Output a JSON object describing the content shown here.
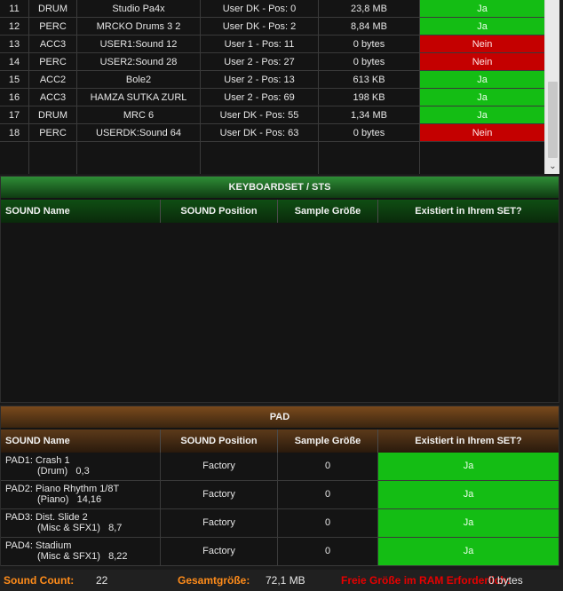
{
  "top_rows": [
    {
      "num": "11",
      "type": "DRUM",
      "name": "Studio Pa4x",
      "position": "User DK - Pos: 0",
      "size": "23,8 MB",
      "exists": "Ja",
      "ok": true
    },
    {
      "num": "12",
      "type": "PERC",
      "name": "MRCKO Drums 3  2",
      "position": "User DK - Pos: 2",
      "size": "8,84 MB",
      "exists": "Ja",
      "ok": true
    },
    {
      "num": "13",
      "type": "ACC3",
      "name": "USER1:Sound 12",
      "position": "User 1 - Pos: 11",
      "size": "0 bytes",
      "exists": "Nein",
      "ok": false
    },
    {
      "num": "14",
      "type": "PERC",
      "name": "USER2:Sound 28",
      "position": "User 2 - Pos: 27",
      "size": "0 bytes",
      "exists": "Nein",
      "ok": false
    },
    {
      "num": "15",
      "type": "ACC2",
      "name": "Bole2",
      "position": "User 2 - Pos: 13",
      "size": "613 KB",
      "exists": "Ja",
      "ok": true
    },
    {
      "num": "16",
      "type": "ACC3",
      "name": "HAMZA SUTKA ZURL",
      "position": "User 2 - Pos: 69",
      "size": "198 KB",
      "exists": "Ja",
      "ok": true
    },
    {
      "num": "17",
      "type": "DRUM",
      "name": "MRC 6",
      "position": "User DK - Pos: 55",
      "size": "1,34 MB",
      "exists": "Ja",
      "ok": true
    },
    {
      "num": "18",
      "type": "PERC",
      "name": "USERDK:Sound 64",
      "position": "User DK - Pos: 63",
      "size": "0 bytes",
      "exists": "Nein",
      "ok": false
    }
  ],
  "columns": {
    "sound_name": "SOUND Name",
    "sound_position": "SOUND Position",
    "sample_size": "Sample Größe",
    "exists": "Existiert in Ihrem SET?"
  },
  "keyboardset": {
    "title": "KEYBOARDSET / STS"
  },
  "pad": {
    "title": "PAD",
    "rows": [
      {
        "label": "PAD1:",
        "name": "Crash 1",
        "category": "(Drum)",
        "value": "0,3",
        "position": "Factory",
        "size": "0",
        "exists": "Ja"
      },
      {
        "label": "PAD2:",
        "name": "Piano Rhythm 1/8T",
        "category": "(Piano)",
        "value": "14,16",
        "position": "Factory",
        "size": "0",
        "exists": "Ja"
      },
      {
        "label": "PAD3:",
        "name": "Dist. Slide 2",
        "category": "(Misc & SFX1)",
        "value": "8,7",
        "position": "Factory",
        "size": "0",
        "exists": "Ja"
      },
      {
        "label": "PAD4:",
        "name": "Stadium",
        "category": "(Misc & SFX1)",
        "value": "8,22",
        "position": "Factory",
        "size": "0",
        "exists": "Ja"
      }
    ]
  },
  "footer": {
    "count_label": "Sound Count:",
    "count_value": "22",
    "total_label": "Gesamtgröße:",
    "total_value": "72,1 MB",
    "free_label": "Freie Größe im RAM Erforderlich:",
    "free_value": "0 bytes"
  },
  "colors": {
    "ja": "#14bd14",
    "nein": "#c40000",
    "orange": "#ff8c1a",
    "red": "#e60000"
  }
}
